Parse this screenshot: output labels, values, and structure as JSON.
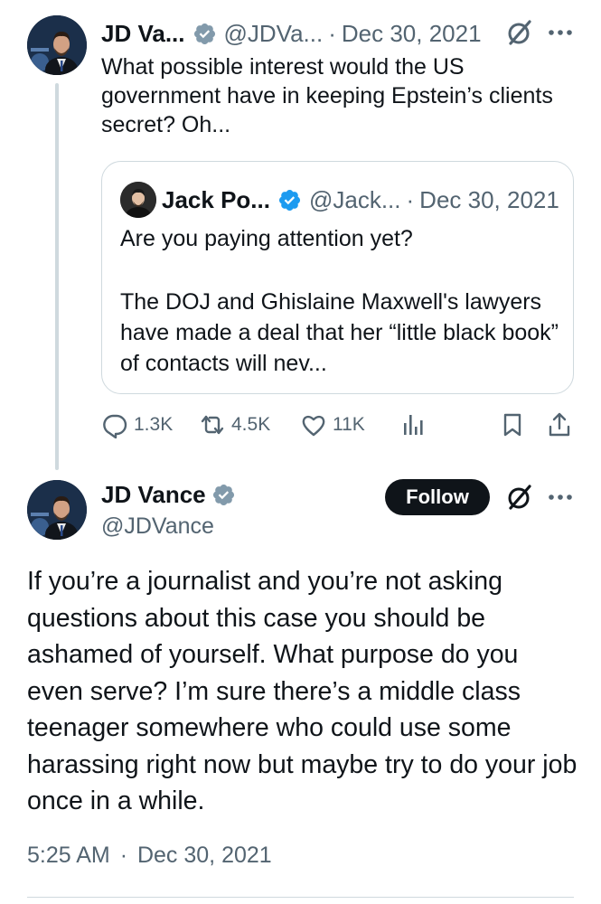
{
  "colors": {
    "text": "#0f1419",
    "secondary": "#536471",
    "verified_blue": "#1d9bf0",
    "verified_gray": "#829aab",
    "border": "#cfd9de",
    "follow_bg": "#0f1419"
  },
  "reply_tweet": {
    "display_name": "JD Va...",
    "handle": "@JDVa...",
    "separator": "·",
    "date": "Dec 30, 2021",
    "text": "What possible interest would the US government have in keeping Epstein’s clients secret? Oh...",
    "avatar_icon": "avatar-jd-vance",
    "verified_icon": "verified-badge-gray-icon",
    "grok_icon": "grok-icon",
    "more_icon": "more-icon"
  },
  "quoted_tweet": {
    "display_name": "Jack Po...",
    "handle": "@Jack...",
    "separator": "·",
    "date": "Dec 30, 2021",
    "line1": "Are you paying attention yet?",
    "line2": "The DOJ and Ghislaine Maxwell's lawyers have made a deal that her “little black book” of contacts will nev...",
    "verified_icon": "verified-badge-blue-icon"
  },
  "actions": {
    "replies": "1.3K",
    "reposts": "4.5K",
    "likes": "11K",
    "icons": [
      "reply-icon",
      "repost-icon",
      "like-icon",
      "views-icon",
      "bookmark-icon",
      "share-icon"
    ]
  },
  "main_tweet": {
    "display_name": "JD Vance",
    "handle": "@JDVance",
    "follow_label": "Follow",
    "text": "If you’re a journalist and you’re not asking questions about this case you should be ashamed of yourself. What purpose do you even serve? I’m sure there’s a middle class teenager somewhere who could use some harassing right now but maybe try to do your job once in a while.",
    "timestamp": "5:25 AM",
    "separator": "·",
    "date": "Dec 30, 2021"
  }
}
